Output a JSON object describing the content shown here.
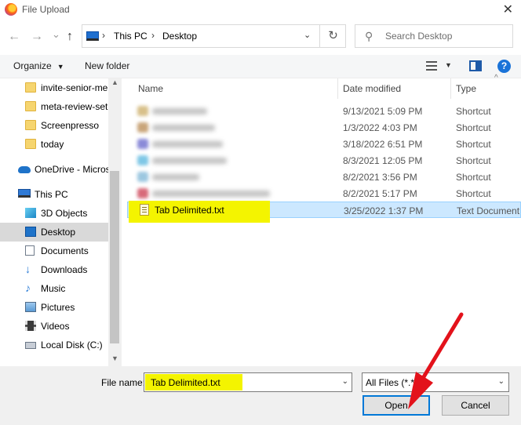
{
  "window": {
    "title": "File Upload",
    "close_glyph": "✕"
  },
  "nav": {
    "back_glyph": "←",
    "forward_glyph": "→",
    "recent_glyph": "⌄",
    "up_glyph": "↑",
    "breadcrumb": [
      "This PC",
      "Desktop"
    ],
    "breadcrumb_sep": "›",
    "dropdown_glyph": "⌄",
    "refresh_glyph": "↻",
    "search_placeholder": "Search Desktop",
    "search_glyph": "⚲"
  },
  "toolbar": {
    "organize_label": "Organize",
    "organize_caret": "▼",
    "new_folder_label": "New folder",
    "view_caret": "▼",
    "help_label": "?"
  },
  "sidebar": {
    "items": [
      {
        "label": "invite-senior-me",
        "icon": "folder-icon"
      },
      {
        "label": "meta-review-set",
        "icon": "folder-icon"
      },
      {
        "label": "Screenpresso",
        "icon": "folder-icon"
      },
      {
        "label": "today",
        "icon": "folder-icon"
      },
      {
        "label": "OneDrive - Micros",
        "icon": "cloud-icon"
      },
      {
        "label": "This PC",
        "icon": "pc-icon"
      },
      {
        "label": "3D Objects",
        "icon": "cube-icon"
      },
      {
        "label": "Desktop",
        "icon": "desktop-icon",
        "selected": true
      },
      {
        "label": "Documents",
        "icon": "document-icon"
      },
      {
        "label": "Downloads",
        "icon": "download-icon"
      },
      {
        "label": "Music",
        "icon": "music-icon"
      },
      {
        "label": "Pictures",
        "icon": "pictures-icon"
      },
      {
        "label": "Videos",
        "icon": "video-icon"
      },
      {
        "label": "Local Disk (C:)",
        "icon": "disk-icon"
      }
    ],
    "scroll_up": "▲",
    "scroll_down": "▼"
  },
  "filelist": {
    "columns": {
      "name": "Name",
      "date": "Date modified",
      "type": "Type"
    },
    "sort_glyph": "^",
    "rows": [
      {
        "name": "",
        "blurred": true,
        "date": "9/13/2021 5:09 PM",
        "type": "Shortcut",
        "icon_color": "#d8c08a"
      },
      {
        "name": "",
        "blurred": true,
        "date": "1/3/2022 4:03 PM",
        "type": "Shortcut",
        "icon_color": "#c9a57a"
      },
      {
        "name": "",
        "blurred": true,
        "date": "3/18/2022 6:51 PM",
        "type": "Shortcut",
        "icon_color": "#8a8ad8"
      },
      {
        "name": "",
        "blurred": true,
        "date": "8/3/2021 12:05 PM",
        "type": "Shortcut",
        "icon_color": "#7ec7e6"
      },
      {
        "name": "",
        "blurred": true,
        "date": "8/2/2021 3:56 PM",
        "type": "Shortcut",
        "icon_color": "#9cc7e0"
      },
      {
        "name": "",
        "blurred": true,
        "date": "8/2/2021 5:17 PM",
        "type": "Shortcut",
        "icon_color": "#d86a7a"
      },
      {
        "name": "Tab Delimited.txt",
        "blurred": false,
        "selected": true,
        "date": "3/25/2022 1:37 PM",
        "type": "Text Document"
      }
    ]
  },
  "footer": {
    "file_name_label": "File name:",
    "file_name_value": "Tab Delimited.txt",
    "file_name_caret": "⌄",
    "file_type_value": "All Files (*.*)",
    "file_type_caret": "⌄",
    "open_label": "Open",
    "cancel_label": "Cancel"
  },
  "colors": {
    "highlight": "#f4f400",
    "selection": "#cce8ff",
    "annotation_arrow": "#e3121b",
    "accent": "#0078d7"
  }
}
